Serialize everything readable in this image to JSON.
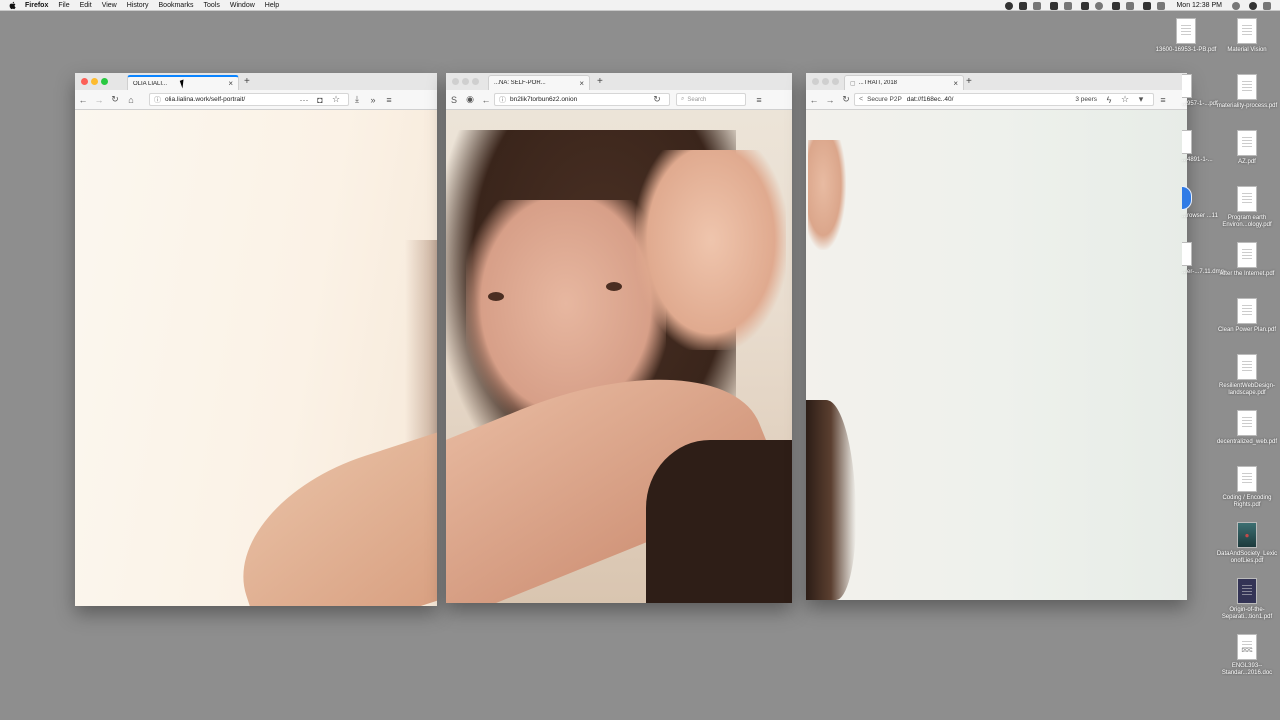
{
  "menubar": {
    "app": "Firefox",
    "menus": [
      "File",
      "Edit",
      "View",
      "History",
      "Bookmarks",
      "Tools",
      "Window",
      "Help"
    ],
    "clock": "Mon 12:38 PM"
  },
  "windows": {
    "firefox": {
      "tab_title": "OLIA LIALI...",
      "url": "olia.lialina.work/self-portrait/"
    },
    "tor": {
      "tab_title": "...NA: SELF-POR...",
      "url": "bn2lik7torbun6z2.onion",
      "search_placeholder": "Search"
    },
    "beaker": {
      "tab_title": "...TRAIT, 2018",
      "secure_label": "Secure P2P",
      "url": "dat://f168ec..40/",
      "peers": "3 peers"
    }
  },
  "desktop": {
    "items": [
      {
        "label": "13600-16953-1-PB.pdf",
        "type": "pdf"
      },
      {
        "label": "Material Vision",
        "type": "pdf"
      },
      {
        "label": "materiality-process.pdf",
        "type": "pdf"
      },
      {
        "label": "AZ.pdf",
        "type": "pdf"
      },
      {
        "label": "Program earth Environ...ology.pdf",
        "type": "pdf"
      },
      {
        "label": "After the Internet.pdf",
        "type": "pdf"
      },
      {
        "label": "Clean Power Plan.pdf",
        "type": "pdf"
      },
      {
        "label": "ResilientWebDesign-landscape.pdf",
        "type": "pdf"
      },
      {
        "label": "decentralized_web.pdf",
        "type": "pdf"
      },
      {
        "label": "Coding / Encoding Rights.pdf",
        "type": "pdf"
      },
      {
        "label": "DataAndSociety_LexiconofLies.pdf",
        "type": "pdf"
      },
      {
        "label": "Origin-of-the-Separati...tion1.pdf",
        "type": "pdf"
      },
      {
        "label": "ENGL393-- Standar...2016.doc",
        "type": "doc",
        "badge": "DOC"
      }
    ],
    "clipped": [
      {
        "label": "...957-1-...pdf"
      },
      {
        "label": "...4891-1-..."
      },
      {
        "label": "...rowser ...11"
      },
      {
        "label": "...er-...7.11.dmg"
      }
    ]
  }
}
